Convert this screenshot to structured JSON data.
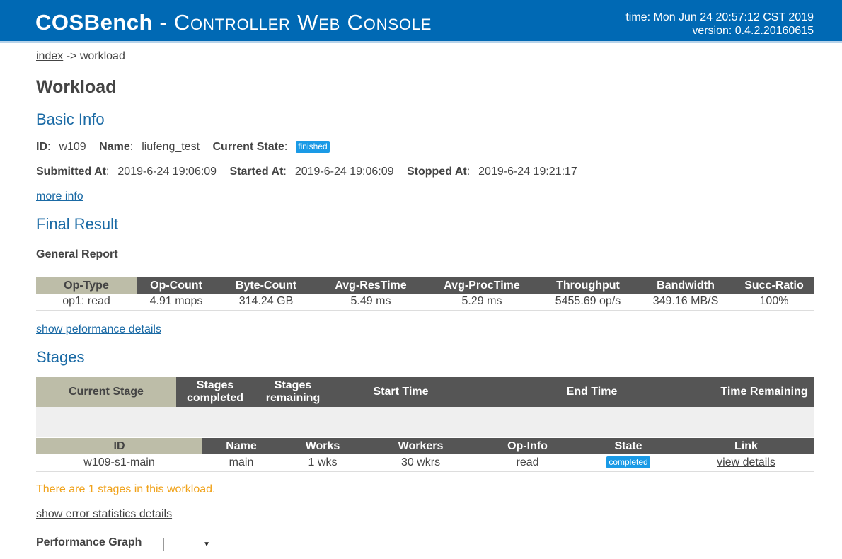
{
  "header": {
    "brand": "COSBench",
    "subtitle": " - Controller Web Console",
    "time": "time: Mon Jun 24 20:57:12 CST 2019",
    "version": "version: 0.4.2.20160615"
  },
  "breadcrumb": {
    "index": "index",
    "sep": " -> ",
    "current": "workload"
  },
  "page_title": "Workload",
  "basic_info": {
    "heading": "Basic Info",
    "id_label": "ID",
    "id": "w109",
    "name_label": "Name",
    "name": "liufeng_test",
    "state_label": "Current State",
    "state": "finished",
    "submitted_label": "Submitted At",
    "submitted": "2019-6-24 19:06:09",
    "started_label": "Started At",
    "started": "2019-6-24 19:06:09",
    "stopped_label": "Stopped At",
    "stopped": "2019-6-24 19:21:17",
    "more_info": "more info"
  },
  "final_result": {
    "heading": "Final Result",
    "report_title": "General Report",
    "columns": [
      "Op-Type",
      "Op-Count",
      "Byte-Count",
      "Avg-ResTime",
      "Avg-ProcTime",
      "Throughput",
      "Bandwidth",
      "Succ-Ratio"
    ],
    "rows": [
      [
        "op1: read",
        "4.91 mops",
        "314.24 GB",
        "5.49 ms",
        "5.29 ms",
        "5455.69 op/s",
        "349.16 MB/S",
        "100%"
      ]
    ],
    "perf_link": "show peformance details"
  },
  "stages": {
    "heading": "Stages",
    "summary_columns": [
      "Current Stage",
      "Stages completed",
      "Stages remaining",
      "Start Time",
      "End Time",
      "Time Remaining"
    ],
    "list_columns": [
      "ID",
      "Name",
      "Works",
      "Workers",
      "Op-Info",
      "State",
      "Link"
    ],
    "list_rows": [
      {
        "id": "w109-s1-main",
        "name": "main",
        "works": "1 wks",
        "workers": "30 wkrs",
        "op_info": "read",
        "state": "completed",
        "link": "view details"
      }
    ],
    "notice": "There are 1 stages in this workload.",
    "error_link": "show error statistics details"
  },
  "perf_graph": {
    "label": "Performance Graph",
    "selected": ""
  },
  "colors": {
    "header_bg": "#0069b4",
    "heading_blue": "#1a6aa5",
    "badge_blue": "#1a9ae6",
    "notice_orange": "#f0a21a",
    "table_head": "#555555",
    "table_first_head": "#bdbda8"
  }
}
